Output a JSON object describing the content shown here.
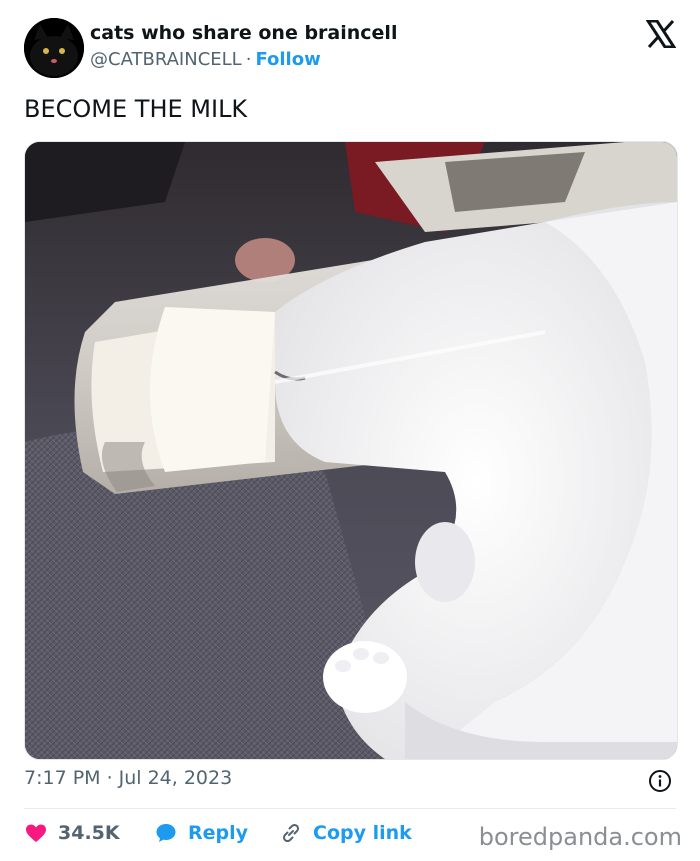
{
  "account": {
    "name": "cats who share one braincell",
    "handle": "@CATBRAINCELL",
    "separator": "·",
    "follow_label": "Follow"
  },
  "tweet": {
    "text": "BECOME THE MILK",
    "media_alt": "white cat with its head inside a glass of milk"
  },
  "meta": {
    "time": "7:17 PM",
    "separator": "·",
    "date": "Jul 24, 2023"
  },
  "actions": {
    "likes": "34.5K",
    "reply_label": "Reply",
    "copy_label": "Copy link"
  },
  "watermark": "boredpanda.com",
  "colors": {
    "accent": "#1d9bf0",
    "like": "#f91880",
    "muted": "#536471",
    "text": "#0f1419"
  },
  "icons": {
    "logo": "x-logo-icon",
    "info": "info-icon",
    "like": "heart-icon",
    "reply": "reply-bubble-icon",
    "copy": "link-icon"
  }
}
